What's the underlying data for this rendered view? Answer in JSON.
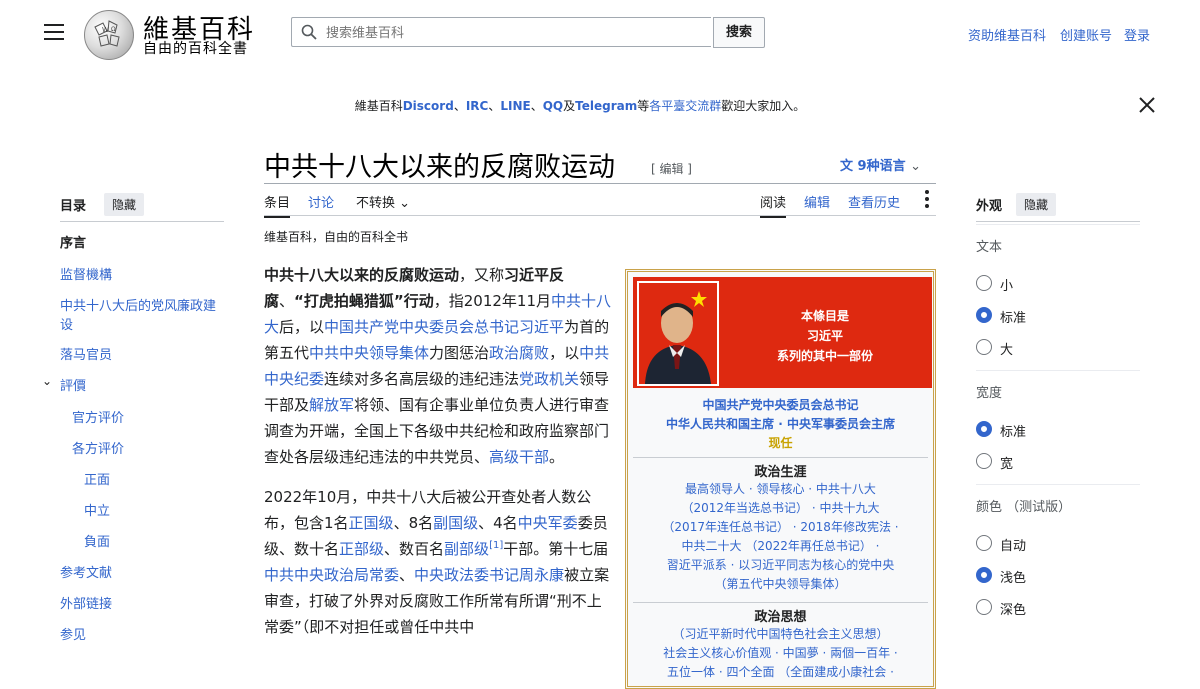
{
  "header": {
    "site_name": "維基百科",
    "tagline": "自由的百科全書",
    "search_placeholder": "搜索维基百科",
    "search_button": "搜索",
    "user_links": [
      "资助维基百科",
      "创建账号",
      "登录"
    ]
  },
  "banner": {
    "prefix": "維基百科",
    "items": [
      "Discord",
      "IRC",
      "LINE",
      "QQ",
      "Telegram"
    ],
    "sep": "、",
    "and": "及",
    "suffix_a": "等",
    "suffix_link": "各平臺交流群",
    "suffix_b": "歡迎大家加入。"
  },
  "article": {
    "title": "中共十八大以来的反腐败运动",
    "edit_label": "[ 编辑 ]",
    "languages": "9种语言",
    "tabs_left": [
      "条目",
      "讨论"
    ],
    "variant": "不转换",
    "tabs_right": [
      "阅读",
      "编辑",
      "查看历史"
    ],
    "from_wiki": "维基百科，自由的百科全书"
  },
  "body": {
    "p1": [
      {
        "t": "中共十八大以来的反腐败运动",
        "b": true
      },
      {
        "t": "，又称"
      },
      {
        "t": "习近平反腐",
        "b": true
      },
      {
        "t": "、"
      },
      {
        "t": "“打虎拍蝇猎狐”行动",
        "b": true
      },
      {
        "t": "，指2012年11月"
      },
      {
        "t": "中共十八大",
        "l": true
      },
      {
        "t": "后，以"
      },
      {
        "t": "中国共产党中央委员会总书记",
        "l": true
      },
      {
        "t": "习近平",
        "l": true
      },
      {
        "t": "为首的第五代"
      },
      {
        "t": "中共中央领导集体",
        "l": true
      },
      {
        "t": "力图惩治"
      },
      {
        "t": "政治腐败",
        "l": true
      },
      {
        "t": "，以"
      },
      {
        "t": "中共中央纪委",
        "l": true
      },
      {
        "t": "连续对多名高层级的违纪违法"
      },
      {
        "t": "党政机关",
        "l": true
      },
      {
        "t": "领导干部及"
      },
      {
        "t": "解放军",
        "l": true
      },
      {
        "t": "将领、国有企事业单位负责人进行审查调查为开端，全国上下各级中共纪检和政府监察部门查处各层级违纪违法的中共党员、"
      },
      {
        "t": "高级干部",
        "l": true
      },
      {
        "t": "。"
      }
    ],
    "p2": [
      {
        "t": "2022年10月，中共十八大后被公开查处者人数公布，包含1名"
      },
      {
        "t": "正国级",
        "l": true
      },
      {
        "t": "、8名"
      },
      {
        "t": "副国级",
        "l": true
      },
      {
        "t": "、4名"
      },
      {
        "t": "中央军委",
        "l": true
      },
      {
        "t": "委员级、数十名"
      },
      {
        "t": "正部级",
        "l": true
      },
      {
        "t": "、数百名"
      },
      {
        "t": "副部级",
        "l": true
      },
      {
        "t": "[1]",
        "l": true,
        "sup": true
      },
      {
        "t": "干部。第十七届"
      },
      {
        "t": "中共中央政治局常委",
        "l": true
      },
      {
        "t": "、"
      },
      {
        "t": "中央政法委书记",
        "l": true
      },
      {
        "t": "周永康",
        "l": true
      },
      {
        "t": "被立案审查，打破了外界对反腐败工作所常有所谓“刑不上常委”（即不对担任或曾任中共中"
      }
    ]
  },
  "toc": {
    "title": "目录",
    "hide": "隐藏",
    "items": [
      {
        "label": "序言",
        "level": 0,
        "current": true
      },
      {
        "label": "监督機構",
        "level": 0
      },
      {
        "label": "中共十八大后的党风廉政建设",
        "level": 0
      },
      {
        "label": "落马官员",
        "level": 0
      },
      {
        "label": "評價",
        "level": 0,
        "expanded": true
      },
      {
        "label": "官方评价",
        "level": 1
      },
      {
        "label": "各方评价",
        "level": 1
      },
      {
        "label": "正面",
        "level": 2
      },
      {
        "label": "中立",
        "level": 2
      },
      {
        "label": "負面",
        "level": 2
      },
      {
        "label": "参考文献",
        "level": 0
      },
      {
        "label": "外部链接",
        "level": 0
      },
      {
        "label": "参见",
        "level": 0
      }
    ]
  },
  "appearance": {
    "title": "外观",
    "hide": "隐藏",
    "text": {
      "label": "文本",
      "options": [
        "小",
        "标准",
        "大"
      ],
      "selected": "标准"
    },
    "width": {
      "label": "宽度",
      "options": [
        "标准",
        "宽"
      ],
      "selected": "标准"
    },
    "color": {
      "label": "颜色 （测试版）",
      "options": [
        "自动",
        "浅色",
        "深色"
      ],
      "selected": "浅色"
    }
  },
  "infobox": {
    "series_lines": [
      "本條目是",
      "习近平",
      "系列的其中一部份"
    ],
    "role1": "中国共产党中央委员会总书记",
    "role2": "中华人民共和国主席 · 中央军事委员会主席",
    "current": "现任",
    "sec1_title": "政治生涯",
    "sec1_lines": [
      "最高领导人 · 领导核心 · 中共十八大",
      "（2012年当选总书记） · 中共十九大",
      "（2017年连任总书记） · 2018年修改宪法 ·",
      "中共二十大 （2022年再任总书记） ·",
      "習近平派系 · 以习近平同志为核心的党中央",
      "（第五代中央领导集体）"
    ],
    "sec2_title": "政治思想",
    "sec2_lines": [
      "（习近平新时代中国特色社会主义思想）",
      "社会主义核心价值观 · 中国夢 · 兩個一百年 ·",
      "五位一体 · 四个全面 （全面建成小康社会 ·"
    ]
  },
  "colors": {
    "link": "#3366cc",
    "infobox_red": "#de2910",
    "gold": "#c8a200"
  }
}
